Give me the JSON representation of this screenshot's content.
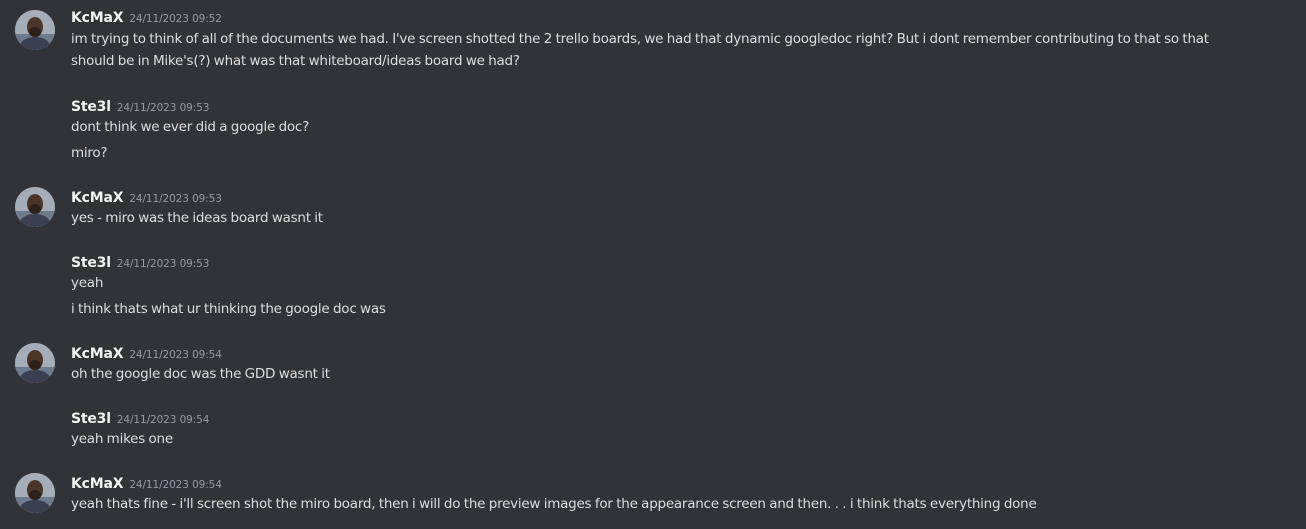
{
  "messages": [
    {
      "author": "KcMaX",
      "time": "24/11/2023 09:52",
      "avatar": "avatar-kcmax",
      "lines": [
        "im trying to think of all of the documents we had. I've screen shotted the 2 trello boards, we had that dynamic googledoc right? But i dont remember contributing to that so that",
        "should be in Mike's(?) what was that whiteboard/ideas board we had?"
      ]
    },
    {
      "author": "Ste3l",
      "time": "24/11/2023 09:53",
      "lines": [
        "dont think we ever did a google doc?",
        "miro?"
      ]
    },
    {
      "author": "KcMaX",
      "time": "24/11/2023 09:53",
      "avatar": "avatar-kcmax",
      "lines": [
        "yes - miro was the ideas board wasnt it"
      ]
    },
    {
      "author": "Ste3l",
      "time": "24/11/2023 09:53",
      "lines": [
        "yeah",
        "i think thats what ur thinking the google doc was"
      ]
    },
    {
      "author": "KcMaX",
      "time": "24/11/2023 09:54",
      "avatar": "avatar-kcmax",
      "lines": [
        "oh the google doc was the GDD wasnt it"
      ]
    },
    {
      "author": "Ste3l",
      "time": "24/11/2023 09:54",
      "lines": [
        "yeah mikes one"
      ]
    },
    {
      "author": "KcMaX",
      "time": "24/11/2023 09:54",
      "avatar": "avatar-kcmax",
      "lines": [
        "yeah thats fine - i'll screen shot the miro board, then i will do the preview images for the appearance screen and then. . . i think thats everything done"
      ]
    }
  ]
}
